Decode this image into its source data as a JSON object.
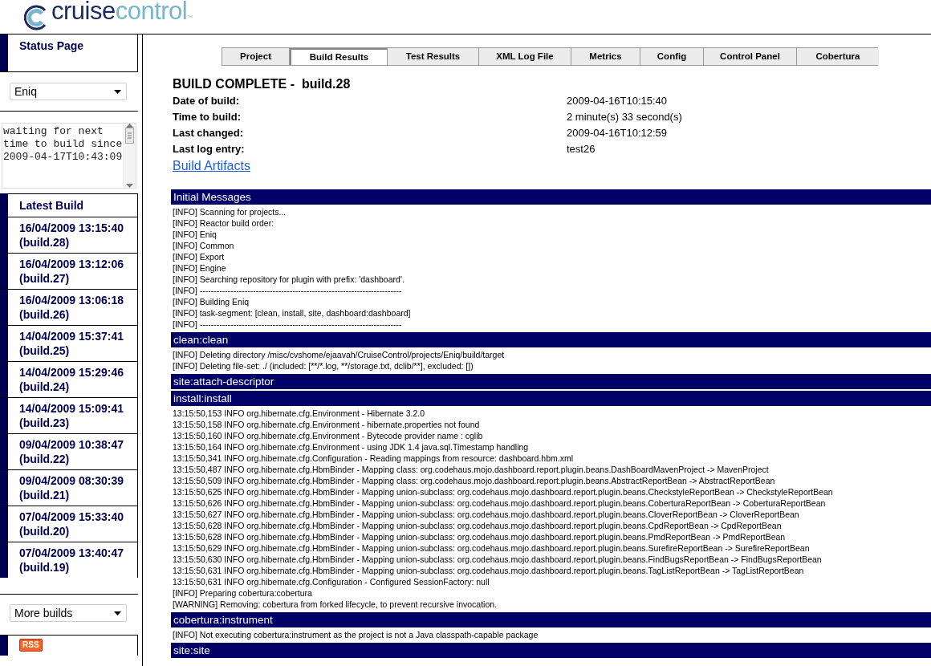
{
  "logo": {
    "brand": "cruise",
    "brand_accent": "control",
    "trademark": "™"
  },
  "sidebar": {
    "status_page": "Status Page",
    "project_select": "Eniq",
    "status_text": "waiting for next time to build since 2009-04-17T10:43:09",
    "latest_build_heading": "Latest Build",
    "builds": [
      {
        "label": "16/04/2009 13:15:40 (build.28)"
      },
      {
        "label": "16/04/2009 13:12:06 (build.27)"
      },
      {
        "label": "16/04/2009 13:06:18 (build.26)"
      },
      {
        "label": "14/04/2009 15:37:41 (build.25)"
      },
      {
        "label": "14/04/2009 15:29:46 (build.24)"
      },
      {
        "label": "14/04/2009 15:09:41 (build.23)"
      },
      {
        "label": "09/04/2009 10:38:47 (build.22)"
      },
      {
        "label": "09/04/2009 08:30:39 (build.21)"
      },
      {
        "label": "07/04/2009 15:33:40 (build.20)"
      },
      {
        "label": "07/04/2009 13:40:47 (build.19)"
      }
    ],
    "more_builds": "More builds",
    "rss": "RSS"
  },
  "tabs": [
    {
      "label": "Project",
      "selected": false
    },
    {
      "label": "Build Results",
      "selected": true
    },
    {
      "label": "Test Results",
      "selected": false
    },
    {
      "label": "XML Log File",
      "selected": false
    },
    {
      "label": "Metrics",
      "selected": false
    },
    {
      "label": "Config",
      "selected": false
    },
    {
      "label": "Control Panel",
      "selected": false
    },
    {
      "label": "Cobertura",
      "selected": false
    }
  ],
  "summary": {
    "title": "BUILD COMPLETE -  build.28",
    "rows": [
      {
        "label": "Date of build:",
        "value": "2009-04-16T10:15:40"
      },
      {
        "label": "Time to build:",
        "value": "2 minute(s) 33 second(s)"
      },
      {
        "label": "Last changed:",
        "value": "2009-04-16T10:12:59"
      },
      {
        "label": "Last log entry:",
        "value": "test26"
      }
    ],
    "artifacts_link": "Build Artifacts"
  },
  "log_sections": [
    {
      "title": "Initial Messages",
      "lines": [
        "[INFO] Scanning for projects...",
        "[INFO] Reactor build order:",
        "[INFO] Eniq",
        "[INFO] Common",
        "[INFO] Export",
        "[INFO] Engine",
        "[INFO] Searching repository for plugin with prefix: 'dashboard'.",
        "[INFO] ------------------------------------------------------------------------",
        "[INFO] Building Eniq",
        "[INFO] task-segment: [clean, install, site, dashboard:dashboard]",
        "[INFO] ------------------------------------------------------------------------"
      ]
    },
    {
      "title": "clean:clean",
      "lines": [
        "[INFO] Deleting directory /misc/cvshome/ejaavah/CruiseControl/projects/Eniq/build/target",
        "[INFO] Deleting file-set: ./ (included: [**/*.log, **/storage.txt, dclib/**], excluded: [])"
      ]
    },
    {
      "title": "site:attach-descriptor"
    },
    {
      "title": "install:install",
      "lines": [
        "13:15:50,153 INFO org.hibernate.cfg.Environment - Hibernate 3.2.0",
        "13:15:50,158 INFO org.hibernate.cfg.Environment - hibernate.properties not found",
        "13:15:50,160 INFO org.hibernate.cfg.Environment - Bytecode provider name : cglib",
        "13:15:50,164 INFO org.hibernate.cfg.Environment - using JDK 1.4 java.sql.Timestamp handling",
        "13:15:50,341 INFO org.hibernate.cfg.Configuration - Reading mappings from resource: dashboard.hbm.xml",
        "13:15:50,487 INFO org.hibernate.cfg.HbmBinder - Mapping class: org.codehaus.mojo.dashboard.report.plugin.beans.DashBoardMavenProject -> MavenProject",
        "13:15:50,509 INFO org.hibernate.cfg.HbmBinder - Mapping class: org.codehaus.mojo.dashboard.report.plugin.beans.AbstractReportBean -> AbstractReportBean",
        "13:15:50,625 INFO org.hibernate.cfg.HbmBinder - Mapping union-subclass: org.codehaus.mojo.dashboard.report.plugin.beans.CheckstyleReportBean -> CheckstyleReportBean",
        "13:15:50,626 INFO org.hibernate.cfg.HbmBinder - Mapping union-subclass: org.codehaus.mojo.dashboard.report.plugin.beans.CoberturaReportBean -> CoberturaReportBean",
        "13:15:50,627 INFO org.hibernate.cfg.HbmBinder - Mapping union-subclass: org.codehaus.mojo.dashboard.report.plugin.beans.CloverReportBean -> CloverReportBean",
        "13:15:50,628 INFO org.hibernate.cfg.HbmBinder - Mapping union-subclass: org.codehaus.mojo.dashboard.report.plugin.beans.CpdReportBean -> CpdReportBean",
        "13:15:50,628 INFO org.hibernate.cfg.HbmBinder - Mapping union-subclass: org.codehaus.mojo.dashboard.report.plugin.beans.PmdReportBean -> PmdReportBean",
        "13:15:50,629 INFO org.hibernate.cfg.HbmBinder - Mapping union-subclass: org.codehaus.mojo.dashboard.report.plugin.beans.SurefireReportBean -> SurefireReportBean",
        "13:15:50,630 INFO org.hibernate.cfg.HbmBinder - Mapping union-subclass: org.codehaus.mojo.dashboard.report.plugin.beans.FindBugsReportBean -> FindBugsReportBean",
        "13:15:50,631 INFO org.hibernate.cfg.HbmBinder - Mapping union-subclass: org.codehaus.mojo.dashboard.report.plugin.beans.TagListReportBean -> TagListReportBean",
        "13:15:50,631 INFO org.hibernate.cfg.Configuration - Configured SessionFactory: null",
        "[INFO] Preparing cobertura:cobertura",
        "[WARNING] Removing: cobertura from forked lifecycle, to prevent recursive invocation."
      ]
    },
    {
      "title": "cobertura:instrument",
      "lines": [
        "[INFO] Not executing cobertura:instrument as the project is not a Java classpath-capable package"
      ]
    },
    {
      "title": "site:site"
    }
  ]
}
